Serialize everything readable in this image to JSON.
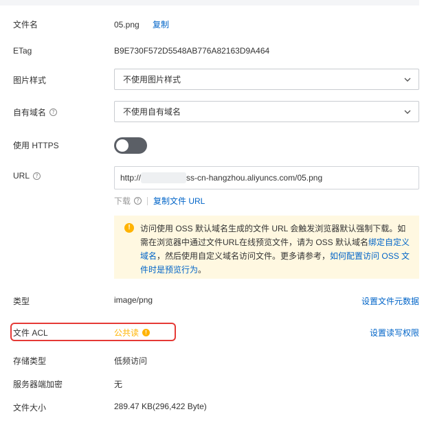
{
  "fields": {
    "filename": {
      "label": "文件名",
      "value": "05.png",
      "copy": "复制"
    },
    "etag": {
      "label": "ETag",
      "value": "B9E730F572D5548AB776A82163D9A464"
    },
    "image_style": {
      "label": "图片样式",
      "selected": "不使用图片样式"
    },
    "custom_domain": {
      "label": "自有域名",
      "selected": "不使用自有域名"
    },
    "https": {
      "label": "使用 HTTPS",
      "on": false
    },
    "url": {
      "label": "URL",
      "prefix": "http://",
      "suffix": "ss-cn-hangzhou.aliyuncs.com/05.png",
      "download": "下载",
      "copy_url": "复制文件 URL"
    },
    "type": {
      "label": "类型",
      "value": "image/png",
      "action": "设置文件元数据"
    },
    "acl": {
      "label": "文件 ACL",
      "value": "公共读",
      "action": "设置读写权限"
    },
    "storage": {
      "label": "存储类型",
      "value": "低频访问"
    },
    "encryption": {
      "label": "服务器端加密",
      "value": "无"
    },
    "size": {
      "label": "文件大小",
      "value": "289.47 KB(296,422 Byte)"
    }
  },
  "notice": {
    "text1": "访问使用 OSS 默认域名生成的文件 URL 会触发浏览器默认强制下载。如需在浏览器中通过文件URL在线预览文件，请为 OSS 默认域名",
    "link1": "绑定自定义域名",
    "text2": "，然后使用自定义域名访问文件。更多请参考，",
    "link2": "如何配置访问 OSS 文件时是预览行为",
    "text3": "。"
  },
  "colors": {
    "link": "#0064c8",
    "warning": "#ffb300",
    "highlight": "#e53935"
  },
  "icons": {
    "help": "help-circle-icon",
    "warning": "warning-circle-icon",
    "chevron": "chevron-down-icon"
  }
}
